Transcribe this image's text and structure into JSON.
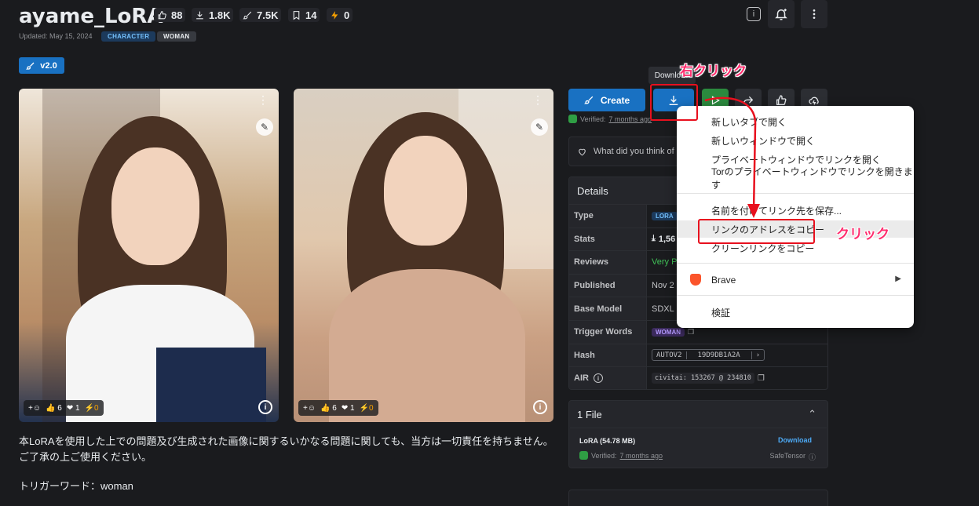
{
  "header": {
    "title": "ayame_LoRA",
    "stats": {
      "likes": "88",
      "downloads": "1.8K",
      "buzz_links": "7.5K",
      "bookmarks": "14",
      "tips": "0"
    },
    "updated": "Updated: May 15, 2024",
    "tags": [
      "CHARACTER",
      "WOMAN"
    ]
  },
  "version_badge": "v2.0",
  "images": [
    {
      "likes": "6",
      "hearts": "1",
      "tips": "0"
    },
    {
      "likes": "6",
      "hearts": "1",
      "tips": "0"
    }
  ],
  "description": {
    "text": "本LoRAを使用した上での問題及び生成された画像に関するいかなる問題に関しても、当方は一切責任を持ちません。ご了承の上ご使用ください。",
    "trigger_line": "トリガーワード：woman"
  },
  "actions": {
    "create_label": "Create",
    "download_tooltip": "Download",
    "verified_prefix": "Verified:",
    "verified_time": "7 months ago",
    "feedback_prompt": "What did you think of"
  },
  "details": {
    "heading": "Details",
    "rows": {
      "type_label": "Type",
      "type_value": "LORA",
      "stats_label": "Stats",
      "stats_value": "1,56",
      "reviews_label": "Reviews",
      "reviews_value": "Very P",
      "published_label": "Published",
      "published_value": "Nov 2",
      "base_model_label": "Base Model",
      "base_model_value": "SDXL 1",
      "trigger_label": "Trigger Words",
      "trigger_value": "WOMAN",
      "hash_label": "Hash",
      "hash_algo": "AUTOV2",
      "hash_value": "19D9DB1A2A",
      "air_label": "AIR",
      "air_value": "civitai: 153267 @ 234810"
    }
  },
  "files": {
    "heading": "1 File",
    "file_name": "LoRA (54.78 MB)",
    "download_label": "Download",
    "verified_prefix": "Verified:",
    "verified_time": "7 months ago",
    "format": "SafeTensor"
  },
  "context_menu": {
    "items": [
      "新しいタブで開く",
      "新しいウィンドウで開く",
      "プライベートウィンドウでリンクを開く",
      "Torのプライベートウィンドウでリンクを開きます",
      "名前を付けてリンク先を保存...",
      "リンクのアドレスをコピー",
      "クリーンリンクをコピー",
      "Brave",
      "検証"
    ]
  },
  "annotations": {
    "right_click": "右クリック",
    "click": "クリック"
  },
  "colors": {
    "accent": "#1971c2",
    "annotation": "#ff2d6e",
    "highlight_box": "#e8101e",
    "tag_bg": "#1c3a5c"
  }
}
